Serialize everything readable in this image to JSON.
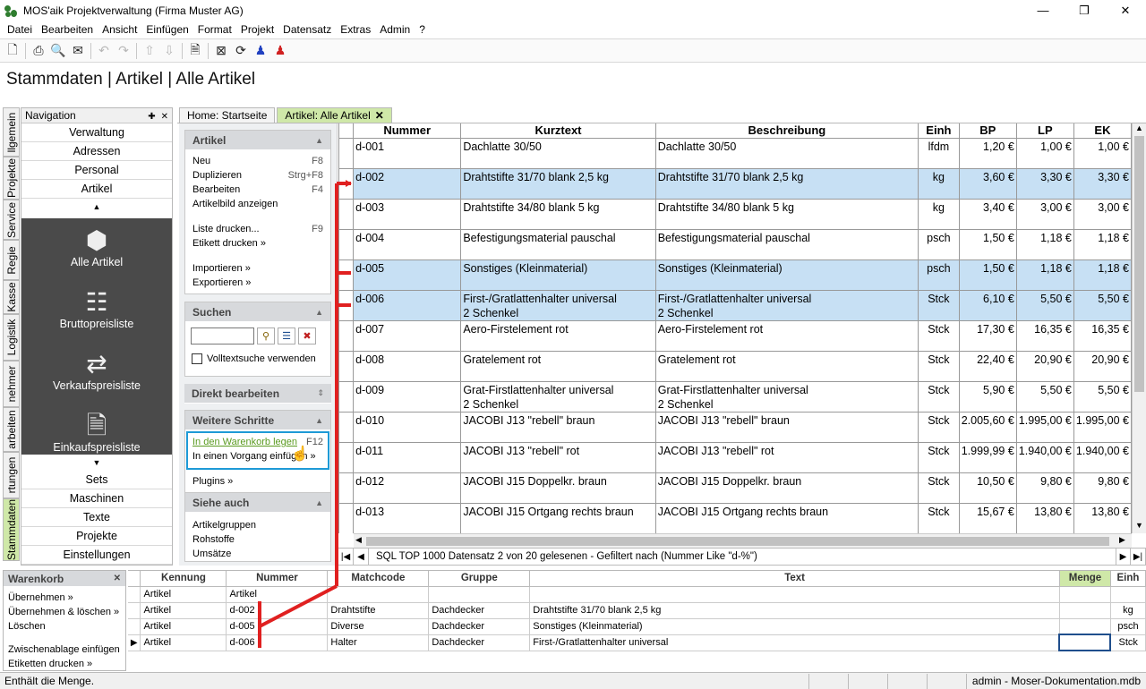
{
  "window": {
    "title": "MOS'aik Projektverwaltung (Firma Muster AG)",
    "minimize": "—",
    "restore": "❐",
    "close": "✕"
  },
  "menu": [
    "Datei",
    "Bearbeiten",
    "Ansicht",
    "Einfügen",
    "Format",
    "Projekt",
    "Datensatz",
    "Extras",
    "Admin",
    "?"
  ],
  "page_title": "Stammdaten | Artikel | Alle Artikel",
  "vertical_tabs": [
    "llgemein",
    "Projekte",
    "Service",
    "Regie",
    "Kasse",
    "Logistik",
    "nehmer",
    "arbeiten",
    "rtungen",
    "Stammdaten"
  ],
  "navigation": {
    "title": "Navigation",
    "pin": "✚",
    "close": "✕",
    "top_items": [
      "Verwaltung",
      "Adressen",
      "Personal",
      "Artikel"
    ],
    "tiles": [
      "Alle Artikel",
      "Bruttopreisliste",
      "Verkaufspreisliste",
      "Einkaufspreisliste"
    ],
    "bottom_items": [
      "Sets",
      "Maschinen",
      "Texte",
      "Projekte",
      "Einstellungen"
    ]
  },
  "doc_tabs": [
    {
      "label": "Home: Startseite"
    },
    {
      "label": "Artikel: Alle Artikel",
      "close": "✕"
    }
  ],
  "taskpane": {
    "artikel": {
      "title": "Artikel",
      "items": [
        {
          "label": "Neu",
          "key": "F8"
        },
        {
          "label": "Duplizieren",
          "key": "Strg+F8"
        },
        {
          "label": "Bearbeiten",
          "key": "F4"
        },
        {
          "label": "Artikelbild anzeigen",
          "key": ""
        },
        {
          "label": "Liste drucken...",
          "key": "F9"
        },
        {
          "label": "Etikett drucken »",
          "key": ""
        },
        {
          "label": "Importieren »",
          "key": ""
        },
        {
          "label": "Exportieren »",
          "key": ""
        }
      ]
    },
    "suchen": {
      "title": "Suchen",
      "search_value": "",
      "fulltext_label": "Volltextsuche verwenden"
    },
    "direkt": {
      "title": "Direkt bearbeiten"
    },
    "weitere": {
      "title": "Weitere Schritte",
      "items": [
        {
          "label": "In den Warenkorb legen",
          "key": "F12"
        },
        {
          "label": "In einen Vorgang einfügen »",
          "key": ""
        }
      ],
      "plugins": "Plugins »"
    },
    "siehe": {
      "title": "Siehe auch",
      "items": [
        "Artikelgruppen",
        "Rohstoffe",
        "Umsätze"
      ]
    }
  },
  "grid": {
    "columns": [
      "Nummer",
      "Kurztext",
      "Beschreibung",
      "Einh",
      "BP",
      "LP",
      "EK"
    ],
    "rows": [
      {
        "nummer": "d-001",
        "kurz1": "Dachlatte 30/50",
        "kurz2": "",
        "besch1": "Dachlatte 30/50",
        "besch2": "",
        "einh": "lfdm",
        "bp": "1,20 €",
        "lp": "1,00 €",
        "ek": "1,00 €",
        "sel": false
      },
      {
        "nummer": "d-002",
        "kurz1": "Drahtstifte 31/70 blank 2,5 kg",
        "kurz2": "",
        "besch1": "Drahtstifte 31/70 blank 2,5 kg",
        "besch2": "",
        "einh": "kg",
        "bp": "3,60 €",
        "lp": "3,30 €",
        "ek": "3,30 €",
        "sel": true
      },
      {
        "nummer": "d-003",
        "kurz1": "Drahtstifte 34/80 blank 5 kg",
        "kurz2": "",
        "besch1": "Drahtstifte 34/80 blank 5 kg",
        "besch2": "",
        "einh": "kg",
        "bp": "3,40 €",
        "lp": "3,00 €",
        "ek": "3,00 €",
        "sel": false
      },
      {
        "nummer": "d-004",
        "kurz1": "Befestigungsmaterial pauschal",
        "kurz2": "",
        "besch1": "Befestigungsmaterial pauschal",
        "besch2": "",
        "einh": "psch",
        "bp": "1,50 €",
        "lp": "1,18 €",
        "ek": "1,18 €",
        "sel": false
      },
      {
        "nummer": "d-005",
        "kurz1": "Sonstiges (Kleinmaterial)",
        "kurz2": "",
        "besch1": "Sonstiges (Kleinmaterial)",
        "besch2": "",
        "einh": "psch",
        "bp": "1,50 €",
        "lp": "1,18 €",
        "ek": "1,18 €",
        "sel": true
      },
      {
        "nummer": "d-006",
        "kurz1": "First-/Gratlattenhalter universal",
        "kurz2": "2 Schenkel",
        "besch1": "First-/Gratlattenhalter universal",
        "besch2": "2 Schenkel",
        "einh": "Stck",
        "bp": "6,10 €",
        "lp": "5,50 €",
        "ek": "5,50 €",
        "sel": true
      },
      {
        "nummer": "d-007",
        "kurz1": "Aero-Firstelement rot",
        "kurz2": "",
        "besch1": "Aero-Firstelement rot",
        "besch2": "",
        "einh": "Stck",
        "bp": "17,30 €",
        "lp": "16,35 €",
        "ek": "16,35 €",
        "sel": false
      },
      {
        "nummer": "d-008",
        "kurz1": "Gratelement rot",
        "kurz2": "",
        "besch1": "Gratelement rot",
        "besch2": "",
        "einh": "Stck",
        "bp": "22,40 €",
        "lp": "20,90 €",
        "ek": "20,90 €",
        "sel": false
      },
      {
        "nummer": "d-009",
        "kurz1": "Grat-Firstlattenhalter universal",
        "kurz2": "2 Schenkel",
        "besch1": "Grat-Firstlattenhalter universal",
        "besch2": "2 Schenkel",
        "einh": "Stck",
        "bp": "5,90 €",
        "lp": "5,50 €",
        "ek": "5,50 €",
        "sel": false
      },
      {
        "nummer": "d-010",
        "kurz1": "JACOBI J13 \"rebell\" braun",
        "kurz2": "",
        "besch1": "JACOBI J13 \"rebell\" braun",
        "besch2": "",
        "einh": "Stck",
        "bp": "2.005,60 €",
        "lp": "1.995,00 €",
        "ek": "1.995,00 €",
        "sel": false
      },
      {
        "nummer": "d-011",
        "kurz1": "JACOBI J13 \"rebell\" rot",
        "kurz2": "",
        "besch1": "JACOBI J13 \"rebell\" rot",
        "besch2": "",
        "einh": "Stck",
        "bp": "1.999,99 €",
        "lp": "1.940,00 €",
        "ek": "1.940,00 €",
        "sel": false
      },
      {
        "nummer": "d-012",
        "kurz1": "JACOBI J15 Doppelkr. braun",
        "kurz2": "",
        "besch1": "JACOBI J15 Doppelkr. braun",
        "besch2": "",
        "einh": "Stck",
        "bp": "10,50 €",
        "lp": "9,80 €",
        "ek": "9,80 €",
        "sel": false
      },
      {
        "nummer": "d-013",
        "kurz1": "JACOBI J15 Ortgang rechts braun",
        "kurz2": "",
        "besch1": "JACOBI J15 Ortgang rechts braun",
        "besch2": "",
        "einh": "Stck",
        "bp": "15,67 €",
        "lp": "13,80 €",
        "ek": "13,80 €",
        "sel": false
      }
    ],
    "status": "SQL TOP 1000 Datensatz 2 von 20 gelesenen - Gefiltert nach (Nummer Like \"d-%\")"
  },
  "warenkorb": {
    "title": "Warenkorb",
    "close": "✕",
    "actions": [
      "Übernehmen »",
      "Übernehmen & löschen »",
      "Löschen",
      "Zwischenablage einfügen",
      "Etiketten drucken »"
    ],
    "columns": [
      "Kennung",
      "Nummer",
      "Matchcode",
      "Gruppe",
      "Text",
      "Menge",
      "Einh"
    ],
    "rows": [
      {
        "kennung": "Artikel",
        "nummer": "Artikel",
        "matchcode": "",
        "gruppe": "",
        "text": "",
        "menge": "",
        "einh": "",
        "cur": false
      },
      {
        "kennung": "Artikel",
        "nummer": "d-002",
        "matchcode": "Drahtstifte",
        "gruppe": "Dachdecker",
        "text": "Drahtstifte 31/70 blank 2,5 kg",
        "menge": "",
        "einh": "kg",
        "cur": false
      },
      {
        "kennung": "Artikel",
        "nummer": "d-005",
        "matchcode": "Diverse",
        "gruppe": "Dachdecker",
        "text": "Sonstiges (Kleinmaterial)",
        "menge": "",
        "einh": "psch",
        "cur": false
      },
      {
        "kennung": "Artikel",
        "nummer": "d-006",
        "matchcode": "Halter",
        "gruppe": "Dachdecker",
        "text": "First-/Gratlattenhalter universal",
        "menge": "",
        "einh": "Stck",
        "cur": true
      }
    ]
  },
  "statusbar": {
    "left": "Enthält die Menge.",
    "right": "admin - Moser-Dokumentation.mdb"
  },
  "colors": {
    "accent_green": "#cfe8a8",
    "selection_blue": "#c7e0f4",
    "annotation_red": "#e02020",
    "highlight_box": "#1e9ad6"
  }
}
